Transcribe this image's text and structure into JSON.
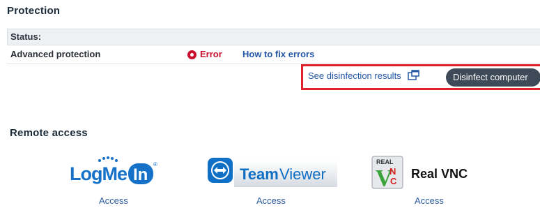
{
  "protection": {
    "title": "Protection",
    "status_header": "Status:",
    "rows": [
      {
        "label": "Advanced protection",
        "status": "Error",
        "fix_link": "How to fix errors"
      }
    ]
  },
  "actions": {
    "see_results": "See disinfection results",
    "disinfect_button": "Disinfect computer",
    "highlight_color": "#e0212a"
  },
  "remote_access": {
    "title": "Remote access",
    "tools": [
      {
        "name": "LogMeIn",
        "logo_text_main": "LogMe",
        "logo_text_in": "In",
        "access": "Access"
      },
      {
        "name": "TeamViewer",
        "logo_text_main": "Team",
        "logo_text_sub": "Viewer",
        "access": "Access"
      },
      {
        "name": "Real VNC",
        "logo_text": "Real VNC",
        "badge_top": "REAL",
        "badge_v": "V",
        "badge_nc": "NC",
        "access": "Access"
      }
    ]
  },
  "colors": {
    "error": "#c8102e",
    "link": "#2357a8",
    "button_bg": "#3e4a57",
    "logmein_blue": "#1572c8",
    "teamviewer_blue": "#0e6fc4"
  }
}
